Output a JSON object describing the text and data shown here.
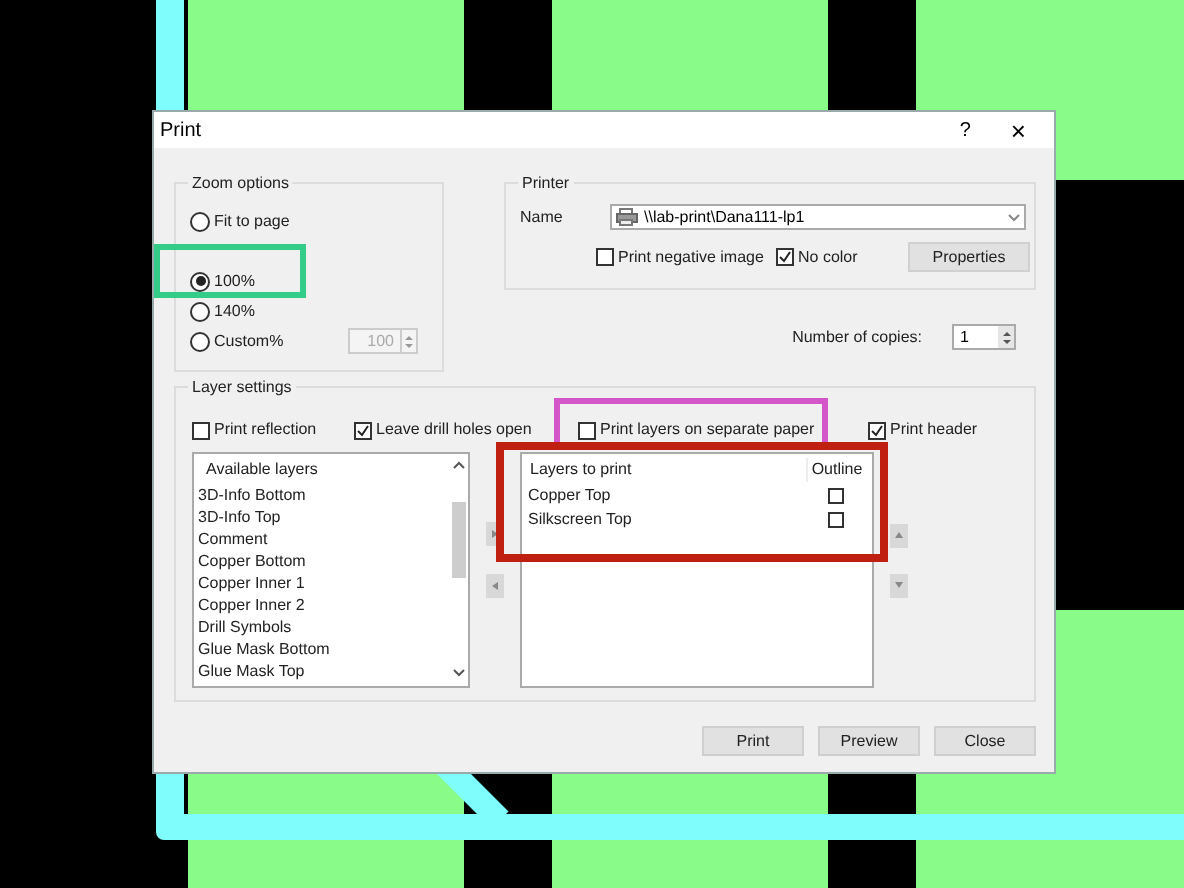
{
  "window": {
    "title": "Print",
    "help": "?",
    "close": "×"
  },
  "zoom_options": {
    "title": "Zoom options",
    "options": [
      {
        "label": "Fit to page",
        "selected": false
      },
      {
        "label": "100%",
        "selected": true
      },
      {
        "label": "140%",
        "selected": false
      },
      {
        "label": "Custom%",
        "selected": false
      }
    ],
    "custom_value": {
      "value": "100",
      "disabled": true
    }
  },
  "printer": {
    "title": "Printer",
    "name_label": "Name",
    "name_value": "\\\\lab-print\\Dana111-lp1",
    "options": [
      {
        "label": "Print negative image",
        "checked": false
      },
      {
        "label": "No color",
        "checked": true
      }
    ],
    "properties_button": "Properties"
  },
  "copies": {
    "label": "Number of copies:",
    "value": "1"
  },
  "layer_settings": {
    "title": "Layer settings",
    "options": [
      {
        "label": "Print reflection",
        "checked": false
      },
      {
        "label": "Leave drill holes open",
        "checked": true
      },
      {
        "label": "Print layers on separate paper",
        "checked": false
      },
      {
        "label": "Print header",
        "checked": true
      }
    ],
    "available_layers": {
      "header": "Available layers",
      "items": [
        "3D-Info Bottom",
        "3D-Info Top",
        "Comment",
        "Copper Bottom",
        "Copper Inner 1",
        "Copper Inner 2",
        "Drill Symbols",
        "Glue Mask Bottom",
        "Glue Mask Top"
      ]
    },
    "layers_to_print": {
      "columns": [
        "Layers to print",
        "Outline"
      ],
      "rows": [
        {
          "name": "Copper Top",
          "outline": false
        },
        {
          "name": "Silkscreen Top",
          "outline": false
        }
      ]
    }
  },
  "buttons": [
    "Print",
    "Preview",
    "Close"
  ]
}
